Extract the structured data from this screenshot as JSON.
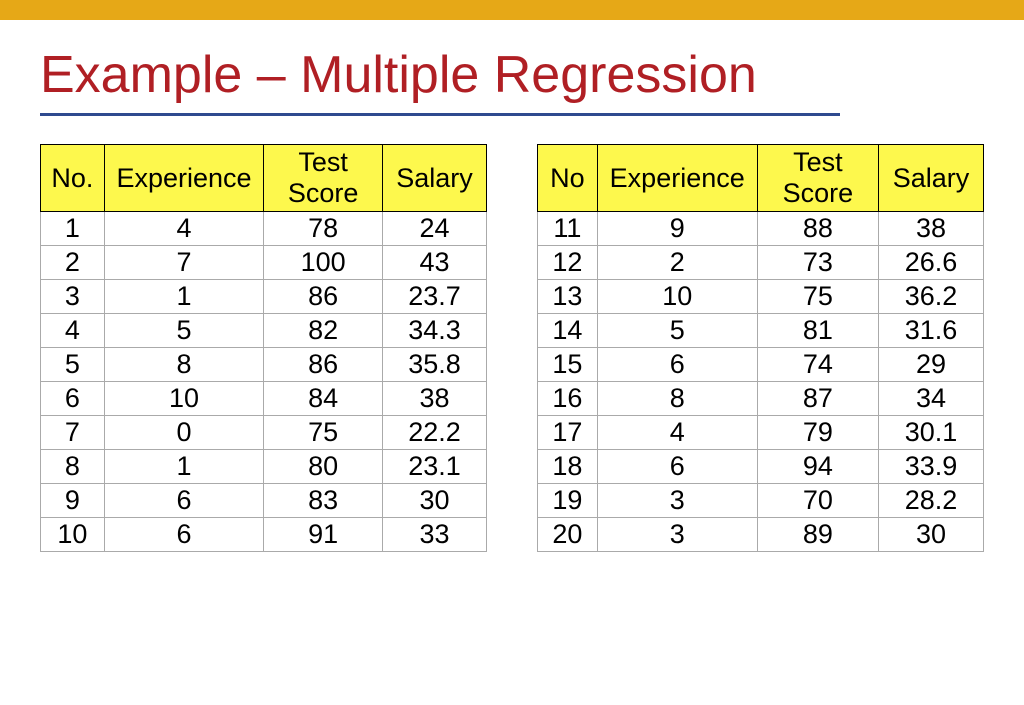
{
  "title": "Example – Multiple Regression",
  "headers_left": {
    "no": "No.",
    "experience": "Experience",
    "test": "Test Score",
    "salary": "Salary"
  },
  "headers_right": {
    "no": "No",
    "experience": "Experience",
    "test": "Test Score",
    "salary": "Salary"
  },
  "left_rows": [
    {
      "no": "1",
      "exp": "4",
      "test": "78",
      "salary": "24"
    },
    {
      "no": "2",
      "exp": "7",
      "test": "100",
      "salary": "43"
    },
    {
      "no": "3",
      "exp": "1",
      "test": "86",
      "salary": "23.7"
    },
    {
      "no": "4",
      "exp": "5",
      "test": "82",
      "salary": "34.3"
    },
    {
      "no": "5",
      "exp": "8",
      "test": "86",
      "salary": "35.8"
    },
    {
      "no": "6",
      "exp": "10",
      "test": "84",
      "salary": "38"
    },
    {
      "no": "7",
      "exp": "0",
      "test": "75",
      "salary": "22.2"
    },
    {
      "no": "8",
      "exp": "1",
      "test": "80",
      "salary": "23.1"
    },
    {
      "no": "9",
      "exp": "6",
      "test": "83",
      "salary": "30"
    },
    {
      "no": "10",
      "exp": "6",
      "test": "91",
      "salary": "33"
    }
  ],
  "right_rows": [
    {
      "no": "11",
      "exp": "9",
      "test": "88",
      "salary": "38"
    },
    {
      "no": "12",
      "exp": "2",
      "test": "73",
      "salary": "26.6"
    },
    {
      "no": "13",
      "exp": "10",
      "test": "75",
      "salary": "36.2"
    },
    {
      "no": "14",
      "exp": "5",
      "test": "81",
      "salary": "31.6"
    },
    {
      "no": "15",
      "exp": "6",
      "test": "74",
      "salary": "29"
    },
    {
      "no": "16",
      "exp": "8",
      "test": "87",
      "salary": "34"
    },
    {
      "no": "17",
      "exp": "4",
      "test": "79",
      "salary": "30.1"
    },
    {
      "no": "18",
      "exp": "6",
      "test": "94",
      "salary": "33.9"
    },
    {
      "no": "19",
      "exp": "3",
      "test": "70",
      "salary": "28.2"
    },
    {
      "no": "20",
      "exp": "3",
      "test": "89",
      "salary": "30"
    }
  ],
  "chart_data": {
    "type": "table",
    "title": "Multiple Regression Example Data",
    "columns": [
      "No",
      "Experience",
      "Test Score",
      "Salary"
    ],
    "rows": [
      [
        1,
        4,
        78,
        24
      ],
      [
        2,
        7,
        100,
        43
      ],
      [
        3,
        1,
        86,
        23.7
      ],
      [
        4,
        5,
        82,
        34.3
      ],
      [
        5,
        8,
        86,
        35.8
      ],
      [
        6,
        10,
        84,
        38
      ],
      [
        7,
        0,
        75,
        22.2
      ],
      [
        8,
        1,
        80,
        23.1
      ],
      [
        9,
        6,
        83,
        30
      ],
      [
        10,
        6,
        91,
        33
      ],
      [
        11,
        9,
        88,
        38
      ],
      [
        12,
        2,
        73,
        26.6
      ],
      [
        13,
        10,
        75,
        36.2
      ],
      [
        14,
        5,
        81,
        31.6
      ],
      [
        15,
        6,
        74,
        29
      ],
      [
        16,
        8,
        87,
        34
      ],
      [
        17,
        4,
        79,
        30.1
      ],
      [
        18,
        6,
        94,
        33.9
      ],
      [
        19,
        3,
        70,
        28.2
      ],
      [
        20,
        3,
        89,
        30
      ]
    ]
  }
}
